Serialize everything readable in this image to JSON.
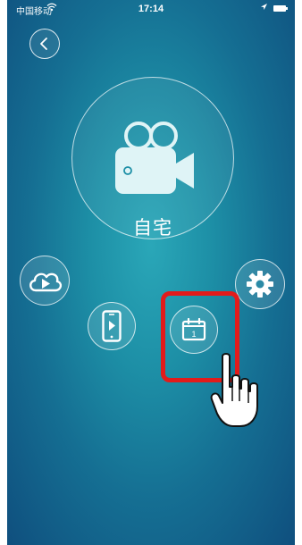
{
  "status_bar": {
    "carrier": "中国移动",
    "time": "17:14"
  },
  "device": {
    "name": "自宅"
  },
  "calendar_icon_day": "1",
  "icons": {
    "back": "chevron-left-icon",
    "camera": "video-camera-icon",
    "cloud_playback": "cloud-play-icon",
    "local_playback": "phone-play-icon",
    "calendar": "calendar-icon",
    "settings": "gear-icon",
    "pointer": "hand-pointer-icon"
  },
  "colors": {
    "highlight": "#e21b1b",
    "background_center": "#2aa7b8",
    "background_edge": "#0f4f7e"
  }
}
